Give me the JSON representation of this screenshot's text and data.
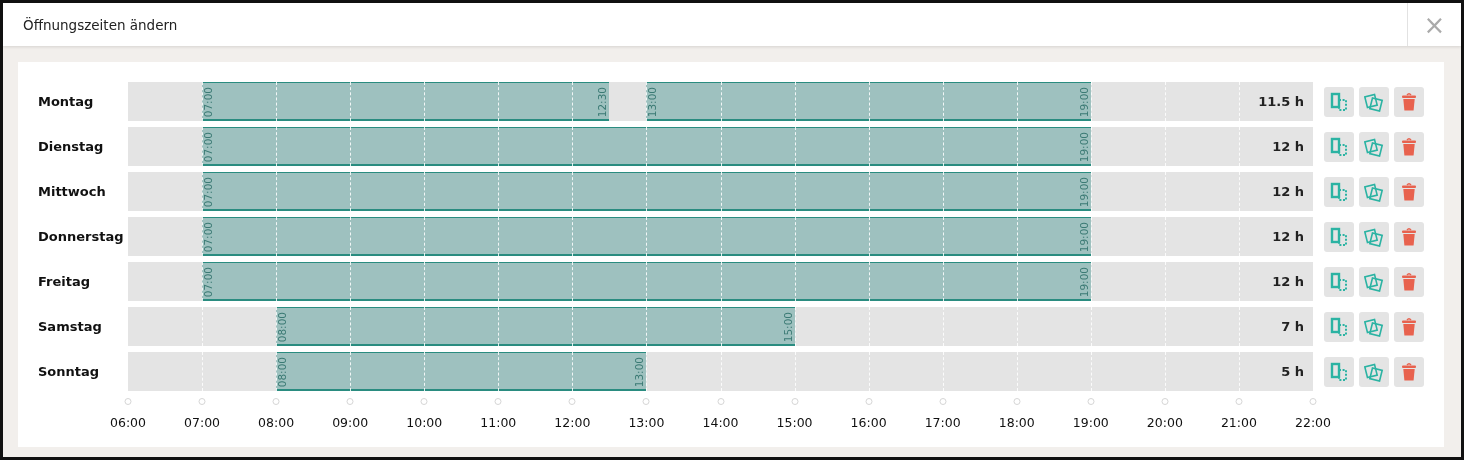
{
  "dialog": {
    "title": "Öffnungszeiten ändern",
    "close": "×"
  },
  "days": [
    {
      "name": "Montag",
      "total": "11.5 h",
      "segments": [
        {
          "start": "07:00",
          "end": "12:30"
        },
        {
          "start": "13:00",
          "end": "19:00"
        }
      ]
    },
    {
      "name": "Dienstag",
      "total": "12 h",
      "segments": [
        {
          "start": "07:00",
          "end": "19:00"
        }
      ]
    },
    {
      "name": "Mittwoch",
      "total": "12 h",
      "segments": [
        {
          "start": "07:00",
          "end": "19:00"
        }
      ]
    },
    {
      "name": "Donnerstag",
      "total": "12 h",
      "segments": [
        {
          "start": "07:00",
          "end": "19:00"
        }
      ]
    },
    {
      "name": "Freitag",
      "total": "12 h",
      "segments": [
        {
          "start": "07:00",
          "end": "19:00"
        }
      ]
    },
    {
      "name": "Samstag",
      "total": "7 h",
      "segments": [
        {
          "start": "08:00",
          "end": "15:00"
        }
      ]
    },
    {
      "name": "Sonntag",
      "total": "5 h",
      "segments": [
        {
          "start": "08:00",
          "end": "13:00"
        }
      ]
    }
  ],
  "axis": {
    "ticks": [
      "06:00",
      "07:00",
      "08:00",
      "09:00",
      "10:00",
      "11:00",
      "12:00",
      "13:00",
      "14:00",
      "15:00",
      "16:00",
      "17:00",
      "18:00",
      "19:00",
      "20:00",
      "21:00",
      "22:00"
    ]
  }
}
